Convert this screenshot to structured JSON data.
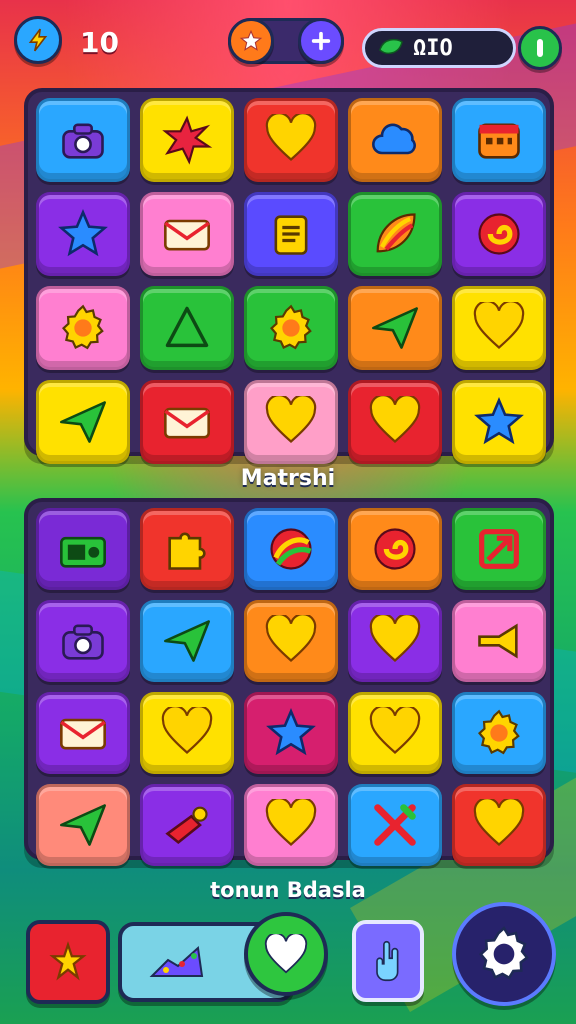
{
  "hud": {
    "moves": "10",
    "score": "ΩΙΟ"
  },
  "board_title": "Matrshi",
  "subtitle": "tonun Bdasla",
  "top_board": {
    "tiles": [
      {
        "icon": "camera-icon",
        "color": "#2aa7ff"
      },
      {
        "icon": "starburst-icon",
        "color": "#ffe100"
      },
      {
        "icon": "heart-icon",
        "color": "#f0342c"
      },
      {
        "icon": "cloud-icon",
        "color": "#ff8a1a"
      },
      {
        "icon": "calendar-icon",
        "color": "#2aa7ff"
      },
      {
        "icon": "star-icon",
        "color": "#8a2ee6"
      },
      {
        "icon": "mail-icon",
        "color": "#ff7fd0"
      },
      {
        "icon": "notepad-icon",
        "color": "#5a4bff"
      },
      {
        "icon": "rainbow-leaf-icon",
        "color": "#29c23a"
      },
      {
        "icon": "swirl-icon",
        "color": "#8a2ee6"
      },
      {
        "icon": "gear-icon",
        "color": "#ff7fd0"
      },
      {
        "icon": "triangle-icon",
        "color": "#29c23a"
      },
      {
        "icon": "gear-icon",
        "color": "#29c23a"
      },
      {
        "icon": "paper-plane-icon",
        "color": "#ff8a1a"
      },
      {
        "icon": "heart-icon",
        "color": "#ffe100"
      },
      {
        "icon": "paper-plane-icon",
        "color": "#ffe100"
      },
      {
        "icon": "mail-icon",
        "color": "#e8232f"
      },
      {
        "icon": "heart-icon",
        "color": "#ff9fc8"
      },
      {
        "icon": "heart-icon",
        "color": "#e8232f"
      },
      {
        "icon": "star-icon",
        "color": "#ffe100"
      }
    ]
  },
  "bottom_board": {
    "tiles": [
      {
        "icon": "radio-icon",
        "color": "#7a2ad6"
      },
      {
        "icon": "puzzle-icon",
        "color": "#f0342c"
      },
      {
        "icon": "rainbow-ball-icon",
        "color": "#2a8cff"
      },
      {
        "icon": "swirl-icon",
        "color": "#ff8a1a"
      },
      {
        "icon": "square-arrow-icon",
        "color": "#29c23a"
      },
      {
        "icon": "camera-icon",
        "color": "#8a2ee6"
      },
      {
        "icon": "paper-plane-icon",
        "color": "#2aa7ff"
      },
      {
        "icon": "heart-icon",
        "color": "#ff8a1a"
      },
      {
        "icon": "heart-icon",
        "color": "#8a2ee6"
      },
      {
        "icon": "trumpet-icon",
        "color": "#ff7fd0"
      },
      {
        "icon": "mail-icon",
        "color": "#8a2ee6"
      },
      {
        "icon": "heart-icon",
        "color": "#ffe100"
      },
      {
        "icon": "star-icon",
        "color": "#d61f6e"
      },
      {
        "icon": "heart-icon",
        "color": "#ffe100"
      },
      {
        "icon": "gear-icon",
        "color": "#2aa7ff"
      },
      {
        "icon": "paper-plane-icon",
        "color": "#ff8a7a"
      },
      {
        "icon": "paint-brush-icon",
        "color": "#8a2ee6"
      },
      {
        "icon": "heart-icon",
        "color": "#ff7fd0"
      },
      {
        "icon": "crossed-tools-icon",
        "color": "#2aa7ff"
      },
      {
        "icon": "heart-icon",
        "color": "#f0342c"
      }
    ]
  },
  "bottom_bar": {
    "left_icon": "boost-star-icon",
    "track_icon": "progress-hill-icon",
    "heart_icon": "heart-icon",
    "hand_icon": "hand-icon",
    "settings_icon": "gear-icon"
  }
}
